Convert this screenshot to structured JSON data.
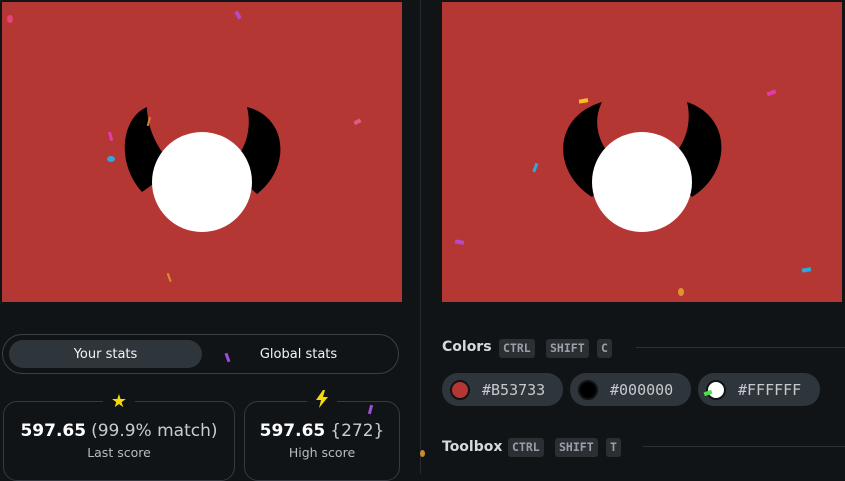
{
  "colors": {
    "background": "#B53733",
    "horns": "#000000",
    "face": "#FFFFFF",
    "page_bg": "#111416"
  },
  "stats_tabs": {
    "your_stats": "Your stats",
    "global_stats": "Global stats"
  },
  "last_score": {
    "icon": "star-icon",
    "value": "597.65",
    "detail": "(99.9% match)",
    "label": "Last score"
  },
  "high_score": {
    "icon": "lightning-icon",
    "value": "597.65",
    "detail": "{272}",
    "label": "High score"
  },
  "colors_section": {
    "title": "Colors",
    "shortcut": [
      "CTRL",
      "SHIFT",
      "C"
    ],
    "swatches": [
      {
        "hex": "#B53733"
      },
      {
        "hex": "#000000"
      },
      {
        "hex": "#FFFFFF"
      }
    ]
  },
  "toolbox_section": {
    "title": "Toolbox",
    "shortcut": [
      "CTRL",
      "SHIFT",
      "T"
    ]
  }
}
